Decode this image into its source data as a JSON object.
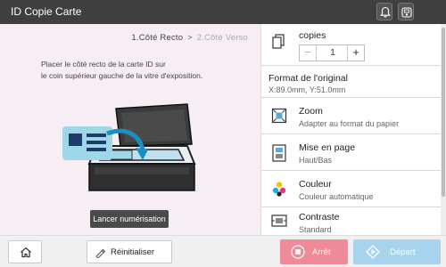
{
  "header": {
    "title": "ID Copie Carte",
    "icons": [
      "bell-icon",
      "device-status-icon"
    ]
  },
  "left": {
    "steps": {
      "current": "1.Côté Recto",
      "separator": ">",
      "next": "2.Côté Verso"
    },
    "instruction": "Placer le côté recto de la carte ID sur\nle coin supérieur gauche de la vitre d'exposition.",
    "start_scan_label": "Lancer numérisation"
  },
  "settings": {
    "copies": {
      "label": "copies",
      "value": "1",
      "minus": "−",
      "plus": "+"
    },
    "original": {
      "title": "Format de l'original",
      "value": "X:89.0mm, Y:51.0mm"
    },
    "zoom": {
      "title": "Zoom",
      "value": "Adapter au format du papier"
    },
    "layout": {
      "title": "Mise en page",
      "value": "Haut/Bas"
    },
    "color": {
      "title": "Couleur",
      "value": "Couleur automatique"
    },
    "contrast": {
      "title": "Contraste",
      "value": "Standard"
    }
  },
  "footer": {
    "reset_label": "Réinitialiser",
    "stop_label": "Arrêt",
    "start_label": "Départ"
  },
  "colors": {
    "header_bg": "#3f3f3f",
    "left_bg": "#f6eef4",
    "stop": "#ef8a98",
    "start": "#a7d3ee"
  }
}
